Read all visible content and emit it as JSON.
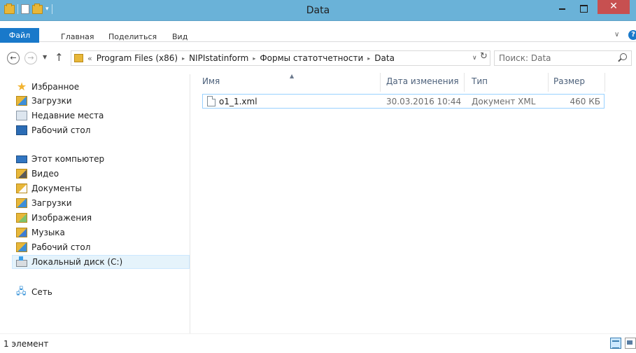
{
  "window": {
    "title": "Data"
  },
  "quick_access": {
    "dropdown": "▾"
  },
  "window_buttons": {
    "close": "✕"
  },
  "ribbon": {
    "tabs": [
      {
        "label": "Файл"
      },
      {
        "label": "Главная"
      },
      {
        "label": "Поделиться"
      },
      {
        "label": "Вид"
      }
    ],
    "help": "?"
  },
  "address": {
    "lead": "«",
    "crumbs": [
      "Program Files (x86)",
      "NIPIstatinform",
      "Формы статотчетности",
      "Data"
    ],
    "separator": "▸"
  },
  "search": {
    "placeholder": "Поиск: Data"
  },
  "nav": {
    "favorites": {
      "label": "Избранное",
      "items": [
        "Загрузки",
        "Недавние места",
        "Рабочий стол"
      ]
    },
    "computer": {
      "label": "Этот компьютер",
      "items": [
        "Видео",
        "Документы",
        "Загрузки",
        "Изображения",
        "Музыка",
        "Рабочий стол",
        "Локальный диск (C:)"
      ]
    },
    "network": {
      "label": "Сеть"
    }
  },
  "file_list": {
    "columns": {
      "name": "Имя",
      "date": "Дата изменения",
      "type": "Тип",
      "size": "Размер"
    },
    "rows": [
      {
        "name": "o1_1.xml",
        "date": "30.03.2016 10:44",
        "type": "Документ XML",
        "size": "460 КБ"
      }
    ]
  },
  "status": {
    "text": "1 элемент"
  },
  "icons": {
    "star": "star-icon",
    "refresh": "refresh-icon",
    "search": "search-icon"
  }
}
